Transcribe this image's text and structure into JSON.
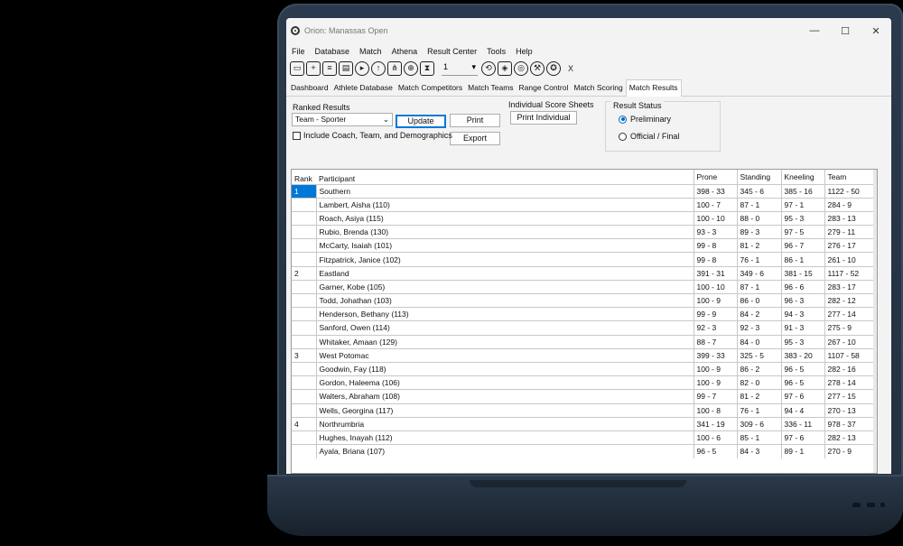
{
  "window": {
    "title": "Orion: Manassas Open",
    "controls": [
      "—",
      "☐",
      "✕"
    ]
  },
  "menu": [
    "File",
    "Database",
    "Match",
    "Athena",
    "Result Center",
    "Tools",
    "Help"
  ],
  "toolbar": {
    "icons": [
      "folder-icon",
      "new-file-icon",
      "document-icon",
      "clipboard-icon",
      "play-icon",
      "upload-icon",
      "network-icon",
      "globe-icon",
      "hourglass-icon"
    ],
    "relay_value": "1",
    "icons2": [
      "team-sync-icon",
      "badge-icon",
      "target-icon",
      "wrench-icon",
      "medal-icon"
    ],
    "close_x": "X"
  },
  "tabs": [
    "Dashboard",
    "Athlete Database",
    "Match Competitors",
    "Match Teams",
    "Range Control",
    "Match Scoring",
    "Match Results"
  ],
  "active_tab": "Match Results",
  "ranked": {
    "label": "Ranked Results",
    "selected": "Team - Sporter",
    "update_label": "Update",
    "print_label": "Print",
    "export_label": "Export",
    "include_label": "Include Coach, Team, and Demographics"
  },
  "individual": {
    "label": "Individual Score Sheets",
    "print_individual_label": "Print Individual"
  },
  "status": {
    "title": "Result Status",
    "preliminary": "Preliminary",
    "official": "Official / Final",
    "selected": "preliminary"
  },
  "table": {
    "headers": {
      "rank": "Rank",
      "participant": "Participant",
      "prone": "Prone",
      "standing": "Standing",
      "kneeling": "Kneeling",
      "team": "Team"
    },
    "rows": [
      {
        "rank": "1",
        "name": "Southern",
        "prone": "398 - 33",
        "standing": "345 - 6",
        "kneeling": "385 - 16",
        "team": "1122 - 50"
      },
      {
        "rank": "",
        "name": "Lambert, Aisha (110)",
        "prone": "100 - 7",
        "standing": "87 - 1",
        "kneeling": "97 - 1",
        "team": "284 - 9"
      },
      {
        "rank": "",
        "name": "Roach, Asiya (115)",
        "prone": "100 - 10",
        "standing": "88 - 0",
        "kneeling": "95 - 3",
        "team": "283 - 13"
      },
      {
        "rank": "",
        "name": "Rubio, Brenda (130)",
        "prone": "93 - 3",
        "standing": "89 - 3",
        "kneeling": "97 - 5",
        "team": "279 - 11"
      },
      {
        "rank": "",
        "name": "McCarty, Isaiah (101)",
        "prone": "99 - 8",
        "standing": "81 - 2",
        "kneeling": "96 - 7",
        "team": "276 - 17"
      },
      {
        "rank": "",
        "name": "Fitzpatrick, Janice (102)",
        "prone": "99 - 8",
        "standing": "76 - 1",
        "kneeling": "86 - 1",
        "team": "261 - 10"
      },
      {
        "rank": "2",
        "name": "Eastland",
        "prone": "391 - 31",
        "standing": "349 - 6",
        "kneeling": "381 - 15",
        "team": "1117 - 52"
      },
      {
        "rank": "",
        "name": "Garner, Kobe (105)",
        "prone": "100 - 10",
        "standing": "87 - 1",
        "kneeling": "96 - 6",
        "team": "283 - 17"
      },
      {
        "rank": "",
        "name": "Todd, Johathan (103)",
        "prone": "100 - 9",
        "standing": "86 - 0",
        "kneeling": "96 - 3",
        "team": "282 - 12"
      },
      {
        "rank": "",
        "name": "Henderson, Bethany (113)",
        "prone": "99 - 9",
        "standing": "84 - 2",
        "kneeling": "94 - 3",
        "team": "277 - 14"
      },
      {
        "rank": "",
        "name": "Sanford, Owen (114)",
        "prone": "92 - 3",
        "standing": "92 - 3",
        "kneeling": "91 - 3",
        "team": "275 - 9"
      },
      {
        "rank": "",
        "name": "Whitaker, Amaan (129)",
        "prone": "88 - 7",
        "standing": "84 - 0",
        "kneeling": "95 - 3",
        "team": "267 - 10"
      },
      {
        "rank": "3",
        "name": "West Potomac",
        "prone": "399 - 33",
        "standing": "325 - 5",
        "kneeling": "383 - 20",
        "team": "1107 - 58"
      },
      {
        "rank": "",
        "name": "Goodwin, Fay (118)",
        "prone": "100 - 9",
        "standing": "86 - 2",
        "kneeling": "96 - 5",
        "team": "282 - 16"
      },
      {
        "rank": "",
        "name": "Gordon, Haleema (106)",
        "prone": "100 - 9",
        "standing": "82 - 0",
        "kneeling": "96 - 5",
        "team": "278 - 14"
      },
      {
        "rank": "",
        "name": "Walters, Abraham (108)",
        "prone": "99 - 7",
        "standing": "81 - 2",
        "kneeling": "97 - 6",
        "team": "277 - 15"
      },
      {
        "rank": "",
        "name": "Wells, Georgina (117)",
        "prone": "100 - 8",
        "standing": "76 - 1",
        "kneeling": "94 - 4",
        "team": "270 - 13"
      },
      {
        "rank": "4",
        "name": "Northrumbria",
        "prone": "341 - 19",
        "standing": "309 - 6",
        "kneeling": "336 - 11",
        "team": "978 - 37"
      },
      {
        "rank": "",
        "name": "Hughes, Inayah (112)",
        "prone": "100 - 6",
        "standing": "85 - 1",
        "kneeling": "97 - 6",
        "team": "282 - 13"
      },
      {
        "rank": "",
        "name": "Ayala, Briana (107)",
        "prone": "96 - 5",
        "standing": "84 - 3",
        "kneeling": "89 - 1",
        "team": "270 - 9"
      }
    ]
  },
  "colors": {
    "selection": "#0078d7",
    "laptop": "#2b3a4c"
  }
}
